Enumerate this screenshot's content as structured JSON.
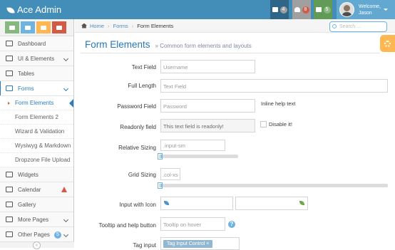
{
  "navbar": {
    "brand": "Ace Admin",
    "badges": [
      {
        "icon": "tasks-icon",
        "count": "4"
      },
      {
        "icon": "bell-icon",
        "count": "8"
      },
      {
        "icon": "envelope-icon",
        "count": "5"
      }
    ],
    "user": {
      "welcome": "Welcome,",
      "name": "Jason"
    }
  },
  "sidebar": {
    "shortcuts": [
      "signal-icon",
      "pencil-icon",
      "users-icon",
      "cogs-icon"
    ],
    "items": [
      {
        "label": "Dashboard",
        "icon": "dashboard-icon"
      },
      {
        "label": "UI & Elements",
        "icon": "desktop-icon"
      },
      {
        "label": "Tables",
        "icon": "list-icon"
      },
      {
        "label": "Forms",
        "icon": "edit-icon"
      },
      {
        "label": "Widgets",
        "icon": "widgets-icon"
      },
      {
        "label": "Calendar",
        "icon": "calendar-icon"
      },
      {
        "label": "Gallery",
        "icon": "picture-icon"
      },
      {
        "label": "More Pages",
        "icon": "tag-icon"
      },
      {
        "label": "Other Pages",
        "icon": "file-icon",
        "badge": "5"
      }
    ],
    "forms_submenu": [
      "Form Elements",
      "Form Elements 2",
      "Wizard & Validation",
      "Wysiwyg & Markdown",
      "Dropzone File Upload"
    ]
  },
  "breadcrumb": {
    "home": "Home",
    "section": "Forms",
    "current": "Form Elements"
  },
  "search": {
    "placeholder": "Search ..."
  },
  "page": {
    "title": "Form Elements",
    "subtitle": "» Common form elements and layouts"
  },
  "form": {
    "text_field": {
      "label": "Text Field",
      "placeholder": "Username"
    },
    "full_length": {
      "label": "Full Length",
      "placeholder": "Text Field"
    },
    "password": {
      "label": "Password Field",
      "placeholder": "Password",
      "help": "Inline help text"
    },
    "readonly": {
      "label": "Readonly field",
      "value": "This text field is readonly!",
      "checkbox": "Disable it!"
    },
    "relative_sizing": {
      "label": "Relative Sizing",
      "placeholder": ".input-sm"
    },
    "grid_sizing": {
      "label": "Grid Sizing",
      "placeholder": ".col-xs"
    },
    "input_icon": {
      "label": "Input with Icon"
    },
    "tooltip": {
      "label": "Tooltip and help button",
      "placeholder": "Tooltip on hover",
      "help_glyph": "?"
    },
    "tag_input": {
      "label": "Tag input",
      "tag": "Tag Input Control",
      "remove": "×"
    }
  },
  "colors": {
    "navbar": "#438eb9",
    "accent": "#2b7dbc",
    "warning": "#ffb752",
    "danger": "#d15b47",
    "success": "#87b87f"
  }
}
